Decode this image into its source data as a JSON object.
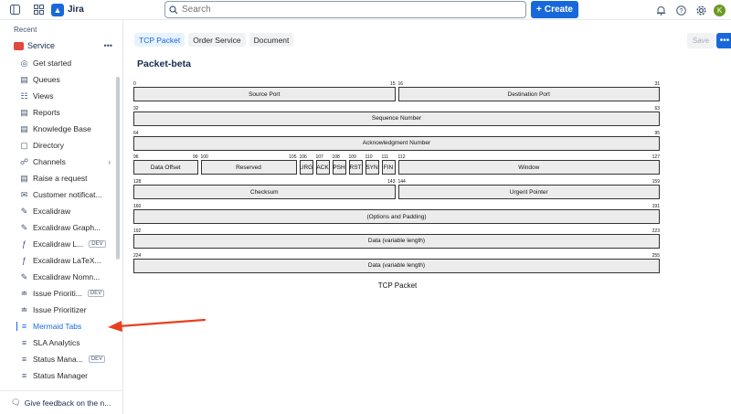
{
  "topbar": {
    "app_name": "Jira",
    "search_placeholder": "Search",
    "create_label": "Create",
    "avatar_initial": "K"
  },
  "sidebar": {
    "recent_label": "Recent",
    "space_name": "Service",
    "space_more": "•••",
    "items": [
      {
        "label": "Get started",
        "icon": "compass-icon"
      },
      {
        "label": "Queues",
        "icon": "queue-icon"
      },
      {
        "label": "Views",
        "icon": "views-icon"
      },
      {
        "label": "Reports",
        "icon": "reports-icon"
      },
      {
        "label": "Knowledge Base",
        "icon": "book-icon"
      },
      {
        "label": "Directory",
        "icon": "directory-icon"
      },
      {
        "label": "Channels",
        "icon": "channels-icon"
      },
      {
        "label": "Raise a request",
        "icon": "request-icon"
      },
      {
        "label": "Customer notificat...",
        "icon": "mail-icon"
      },
      {
        "label": "Excalidraw",
        "icon": "app-icon"
      },
      {
        "label": "Excalidraw Graph...",
        "icon": "app-icon"
      },
      {
        "label": "Excalidraw L...",
        "icon": "fx-icon",
        "badge": "DEV"
      },
      {
        "label": "Excalidraw LaTeX...",
        "icon": "fx-icon"
      },
      {
        "label": "Excalidraw Nomn...",
        "icon": "app-icon"
      },
      {
        "label": "Issue Prioriti...",
        "icon": "flow-icon",
        "badge": "DEV"
      },
      {
        "label": "Issue Prioritizer",
        "icon": "flow-icon"
      },
      {
        "label": "Mermaid Tabs",
        "icon": "mermaid-icon"
      },
      {
        "label": "SLA Analytics",
        "icon": "analytics-icon"
      },
      {
        "label": "Status Mana...",
        "icon": "status-icon",
        "badge": "DEV"
      },
      {
        "label": "Status Manager",
        "icon": "status-icon"
      }
    ],
    "feedback_label": "Give feedback on the n..."
  },
  "main": {
    "tabs": [
      "TCP Packet",
      "Order Service",
      "Document"
    ],
    "save_label": "Save",
    "more_label": "•••",
    "page_title": "Packet-beta"
  },
  "packet": {
    "caption": "TCP Packet",
    "rows": [
      [
        {
          "label": "Source Port",
          "start": 0,
          "end": 15
        },
        {
          "label": "Destination Port",
          "start": 16,
          "end": 31
        }
      ],
      [
        {
          "label": "Sequence Number",
          "start": 32,
          "end": 63
        }
      ],
      [
        {
          "label": "Acknowledgment Number",
          "start": 64,
          "end": 95
        }
      ],
      [
        {
          "label": "Data Offset",
          "start": 96,
          "end": 99
        },
        {
          "label": "Reserved",
          "start": 100,
          "end": 105
        },
        {
          "label": "URG",
          "start": 106,
          "end": 106
        },
        {
          "label": "ACK",
          "start": 107,
          "end": 107
        },
        {
          "label": "PSH",
          "start": 108,
          "end": 108
        },
        {
          "label": "RST",
          "start": 109,
          "end": 109
        },
        {
          "label": "SYN",
          "start": 110,
          "end": 110
        },
        {
          "label": "FIN",
          "start": 111,
          "end": 111
        },
        {
          "label": "Window",
          "start": 112,
          "end": 127
        }
      ],
      [
        {
          "label": "Checksum",
          "start": 128,
          "end": 143
        },
        {
          "label": "Urgent Pointer",
          "start": 144,
          "end": 159
        }
      ],
      [
        {
          "label": "(Options and Padding)",
          "start": 160,
          "end": 191
        }
      ],
      [
        {
          "label": "Data (variable length)",
          "start": 192,
          "end": 223
        }
      ],
      [
        {
          "label": "Data (variable length)",
          "start": 224,
          "end": 255
        }
      ]
    ]
  },
  "colors": {
    "accent": "#1868db",
    "annotation_arrow": "#e8401e",
    "field_fill": "#ececec"
  }
}
